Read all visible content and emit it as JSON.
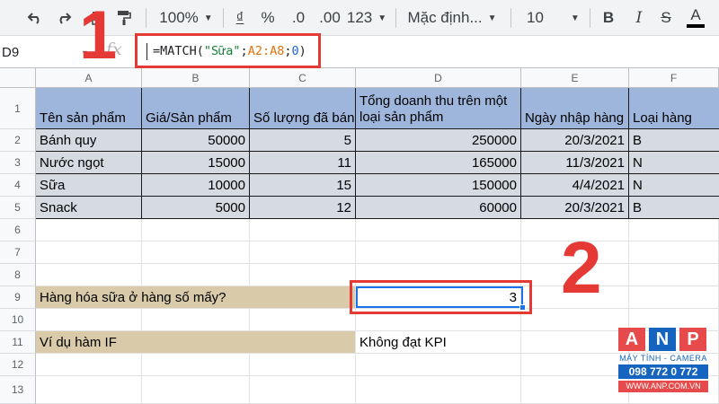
{
  "toolbar": {
    "zoom": "100%",
    "currency": "₫",
    "percent": "%",
    "decrease_decimal": ".0",
    "increase_decimal": ".00",
    "number_format": "123",
    "font_name": "Mặc định...",
    "font_size": "10",
    "bold": "B",
    "italic": "I",
    "strikethrough": "S",
    "text_color": "A",
    "text_color_value": "#000000",
    "icons": [
      "undo-icon",
      "redo-icon",
      "print-icon",
      "paint-format-icon"
    ]
  },
  "formula_bar": {
    "cell_ref": "D9",
    "fx": "fx",
    "formula_parts": {
      "prefix": "=MATCH(",
      "string": "\"Sữa\"",
      "sep1": ";",
      "range": "A2:A8",
      "sep2": ";",
      "arg": "0",
      "suffix": ")"
    }
  },
  "columns": [
    "A",
    "B",
    "C",
    "D",
    "E",
    "F"
  ],
  "rows": [
    "1",
    "2",
    "3",
    "4",
    "5",
    "6",
    "7",
    "8",
    "9",
    "10",
    "11",
    "12",
    "13"
  ],
  "table": {
    "headers": [
      "Tên sản phẩm",
      "Giá/Sản phẩm",
      "Số lượng đã bán",
      "Tổng doanh thu trên một loại sản phẩm",
      "Ngày nhập hàng",
      "Loại hàng"
    ],
    "rows": [
      [
        "Bánh quy",
        "50000",
        "5",
        "250000",
        "20/3/2021",
        "B"
      ],
      [
        "Nước ngọt",
        "15000",
        "11",
        "165000",
        "11/3/2021",
        "N"
      ],
      [
        "Sữa",
        "10000",
        "15",
        "150000",
        "4/4/2021",
        "N"
      ],
      [
        "Snack",
        "5000",
        "12",
        "60000",
        "20/3/2021",
        "B"
      ]
    ]
  },
  "extra": {
    "a9_label": "Hàng hóa sữa ở hàng số mấy?",
    "d9_value": "3",
    "a11_label": "Ví dụ hàm IF",
    "d11_value": "Không đạt KPI"
  },
  "annotations": {
    "step1": "1",
    "step2": "2"
  },
  "watermark": {
    "letters": [
      "A",
      "N",
      "P"
    ],
    "subtitle": "MÁY TÍNH - CAMERA",
    "phone": "098 772 0 772",
    "url": "WWW.ANP.COM.VN"
  },
  "colors": {
    "header_fill": "#9fb6dc",
    "data_fill": "#d6dbe2",
    "label_fill": "#d9cbaa",
    "annotation_red": "#e53935",
    "selection_blue": "#1a73e8"
  }
}
